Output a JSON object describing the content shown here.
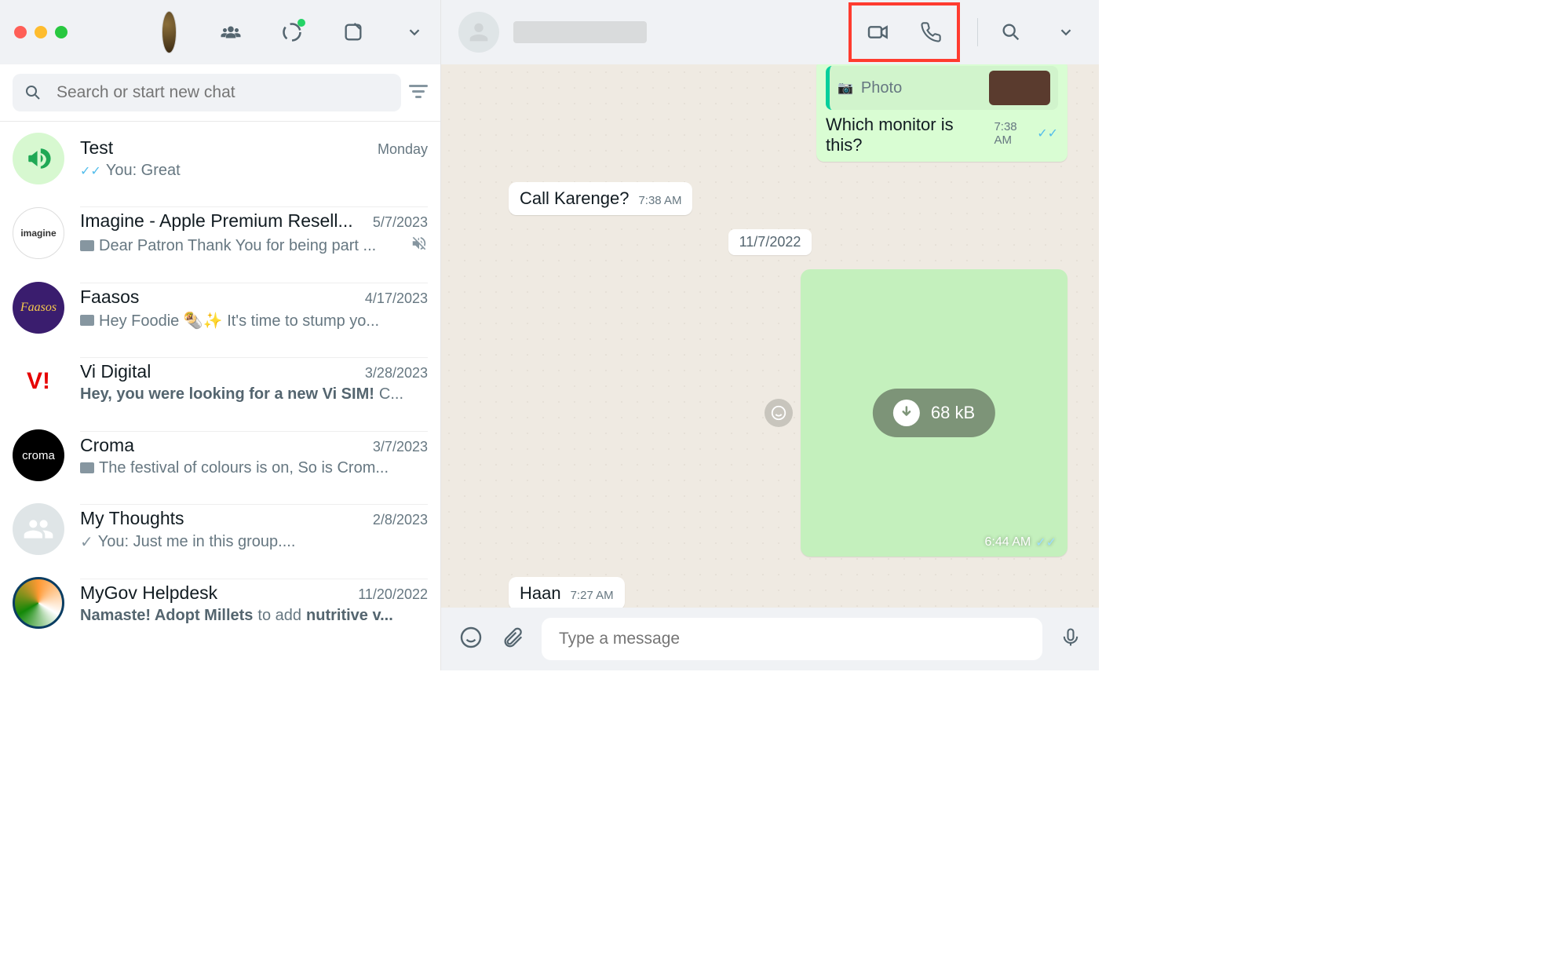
{
  "sidebar": {
    "search_placeholder": "Search or start new chat",
    "chats": [
      {
        "name": "Test",
        "time": "Monday",
        "preview": "You: Great",
        "tick": true
      },
      {
        "name": "Imagine - Apple Premium Resell...",
        "time": "5/7/2023",
        "preview": "Dear Patron Thank You for being part ...",
        "cam": true,
        "muted": true
      },
      {
        "name": "Faasos",
        "time": "4/17/2023",
        "preview": "Hey Foodie 🌯✨ It's time to stump yo...",
        "cam": true
      },
      {
        "name": "Vi Digital",
        "time": "3/28/2023",
        "preview_bold": "Hey, you were looking for a new Vi SIM!",
        "preview_tail": " C..."
      },
      {
        "name": "Croma",
        "time": "3/7/2023",
        "preview": "The festival of colours is on,  So is Crom...",
        "cam": true
      },
      {
        "name": "My Thoughts",
        "time": "2/8/2023",
        "preview": "You: Just me in this group....",
        "sent": true
      },
      {
        "name": "MyGov Helpdesk",
        "time": "11/20/2022",
        "preview_bold": "Namaste! Adopt Millets",
        "preview_mid": " to add ",
        "preview_bold2": "nutritive v..."
      }
    ]
  },
  "chat": {
    "photo_label": "Photo",
    "photo_caption": "Which monitor is this?",
    "photo_time": "7:38 AM",
    "in1_text": "Call Karenge?",
    "in1_time": "7:38 AM",
    "date": "11/7/2022",
    "dl_size": "68 kB",
    "img_time": "6:44 AM",
    "in2_text": "Haan",
    "in2_time": "7:27 AM",
    "compose_placeholder": "Type a message"
  }
}
